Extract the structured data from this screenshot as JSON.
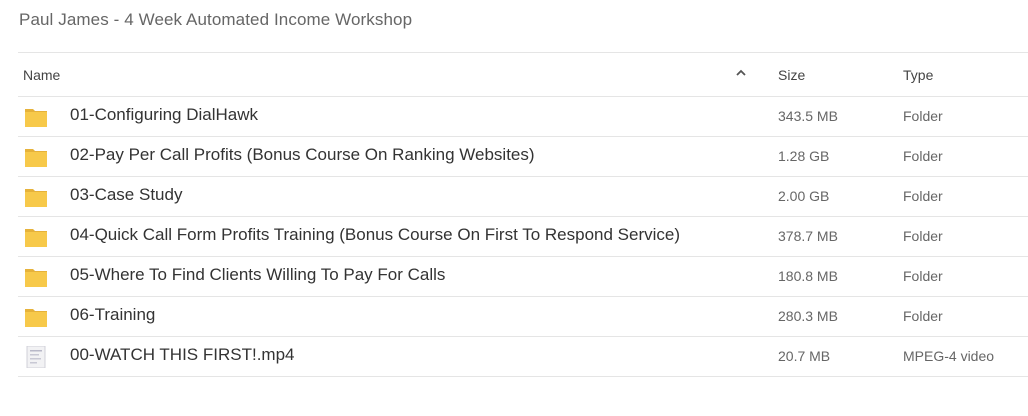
{
  "breadcrumb": "Paul James - 4 Week Automated Income Workshop",
  "columns": {
    "name": "Name",
    "size": "Size",
    "type": "Type",
    "sort_direction": "ascending"
  },
  "files": [
    {
      "name": "01-Configuring DialHawk",
      "size": "343.5 MB",
      "type": "Folder",
      "icon": "folder-icon"
    },
    {
      "name": "02-Pay Per Call Profits (Bonus Course On Ranking Websites)",
      "size": "1.28 GB",
      "type": "Folder",
      "icon": "folder-icon"
    },
    {
      "name": "03-Case Study",
      "size": "2.00 GB",
      "type": "Folder",
      "icon": "folder-icon"
    },
    {
      "name": "04-Quick Call Form Profits Training (Bonus Course On First To Respond Service)",
      "size": "378.7 MB",
      "type": "Folder",
      "icon": "folder-icon"
    },
    {
      "name": "05-Where To Find Clients Willing To Pay For Calls",
      "size": "180.8 MB",
      "type": "Folder",
      "icon": "folder-icon"
    },
    {
      "name": "06-Training",
      "size": "280.3 MB",
      "type": "Folder",
      "icon": "folder-icon"
    },
    {
      "name": "00-WATCH THIS FIRST!.mp4",
      "size": "20.7 MB",
      "type": "MPEG-4 video",
      "icon": "video-file-icon"
    }
  ],
  "colors": {
    "folder": "#f7c94a",
    "folder_dark": "#e6b23a",
    "border": "#e5e5e5"
  }
}
